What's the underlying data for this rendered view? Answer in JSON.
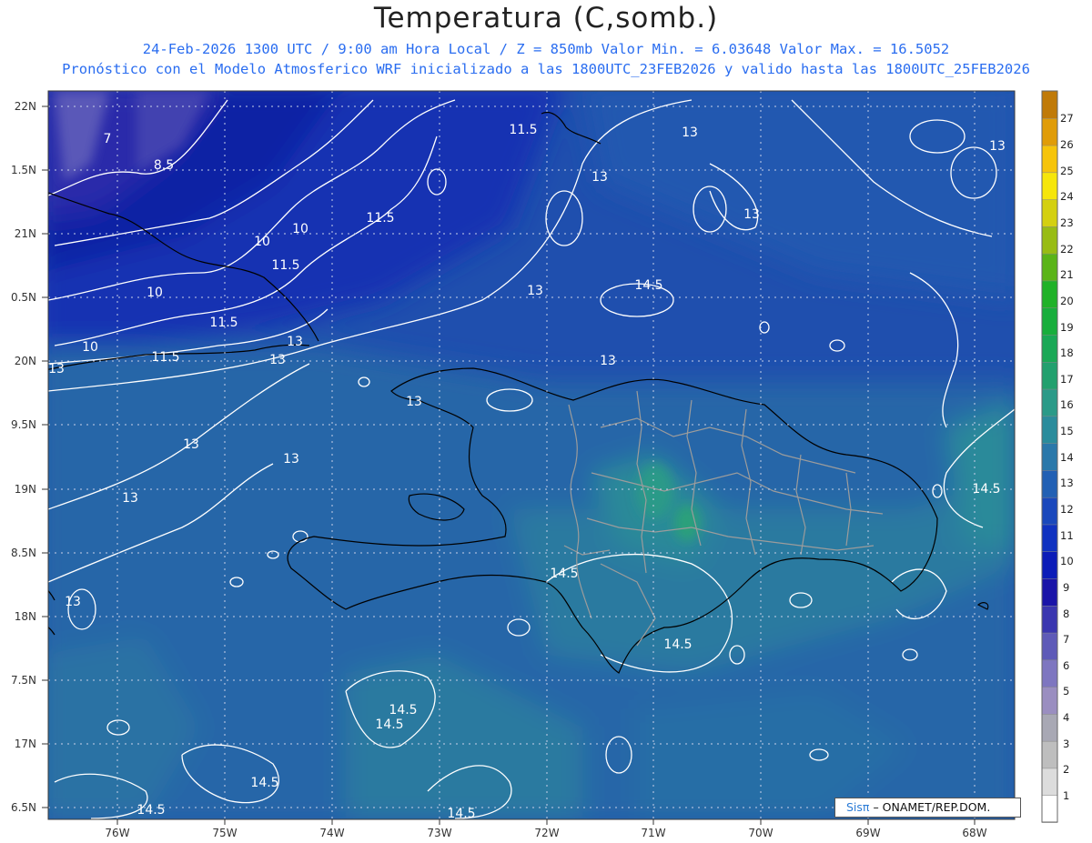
{
  "header": {
    "title": "Temperatura (C,somb.)",
    "line1": "24-Feb-2026  1300 UTC / 9:00 am Hora Local / Z = 850mb    Valor Min. = 6.03648  Valor Max. = 16.5052",
    "line2": "Pronóstico con el Modelo Atmosferico WRF inicializado a las 1800UTC_23FEB2026 y valido hasta las  1800UTC_25FEB2026"
  },
  "map": {
    "lat_labels": [
      "22N",
      "1.5N",
      "21N",
      "0.5N",
      "20N",
      "9.5N",
      "19N",
      "8.5N",
      "18N",
      "7.5N",
      "17N",
      "6.5N"
    ],
    "lon_labels": [
      "76W",
      "75W",
      "74W",
      "73W",
      "72W",
      "71W",
      "70W",
      "69W",
      "68W"
    ],
    "contour_labels": [
      "7",
      "8.5",
      "10",
      "10",
      "11.5",
      "11.5",
      "10",
      "11.5",
      "10",
      "11.5",
      "13",
      "13",
      "13",
      "11.5",
      "13",
      "13",
      "13",
      "13",
      "14.5",
      "13",
      "13",
      "13",
      "13",
      "13",
      "13",
      "14.5",
      "14.5",
      "14.5",
      "14.5",
      "14.5",
      "14.5",
      "14.5",
      "14.5",
      "13"
    ]
  },
  "colorbar": {
    "ticks": [
      "1",
      "2",
      "3",
      "4",
      "5",
      "6",
      "7",
      "8",
      "9",
      "10",
      "11",
      "12",
      "13",
      "14",
      "15",
      "16",
      "17",
      "18",
      "19",
      "20",
      "21",
      "22",
      "23",
      "24",
      "25",
      "26",
      "27"
    ],
    "colors": [
      "#ffffff",
      "#dcdcdc",
      "#bebebe",
      "#a8a8b4",
      "#9a8ec0",
      "#7e76c0",
      "#5e5ab8",
      "#3a36b0",
      "#1a14a8",
      "#0c1cb8",
      "#1032c0",
      "#1a48bc",
      "#2260b4",
      "#2a78aa",
      "#2a8c9c",
      "#2a9a88",
      "#22a06e",
      "#1aa856",
      "#18ae3c",
      "#20b228",
      "#5ab418",
      "#98bc14",
      "#d4d010",
      "#f6e60a",
      "#f6c40a",
      "#e09c08",
      "#c07a08"
    ]
  },
  "footer": {
    "brand": "Sisπ",
    "text": "– ONAMET/REP.DOM."
  }
}
